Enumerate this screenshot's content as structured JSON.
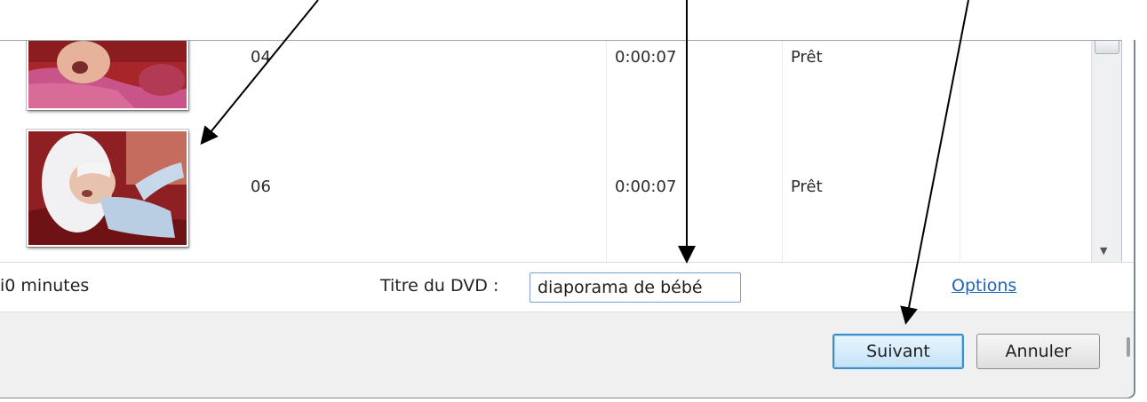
{
  "list": {
    "rows": [
      {
        "name": "04",
        "duration": "0:00:07",
        "status": "Prêt"
      },
      {
        "name": "06",
        "duration": "0:00:07",
        "status": "Prêt"
      }
    ]
  },
  "info": {
    "duration_text": "i0 minutes",
    "dvd_title_label": "Titre du DVD :",
    "dvd_title_value": "diaporama de bébé",
    "options_link": "Options"
  },
  "buttons": {
    "next": "Suivant",
    "cancel": "Annuler"
  }
}
